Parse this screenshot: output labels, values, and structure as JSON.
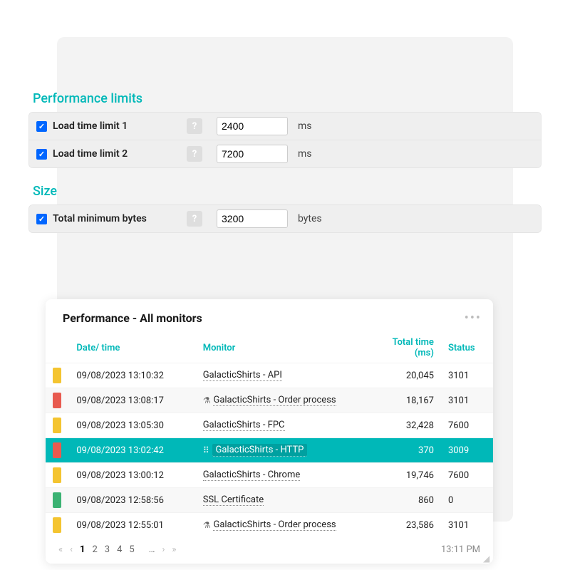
{
  "colors": {
    "accent": "#00b8b8",
    "chip_yellow": "#f4c430",
    "chip_red": "#e85a4f",
    "chip_green": "#3bb273"
  },
  "limits": {
    "title": "Performance limits",
    "rows": [
      {
        "label": "Load time limit 1",
        "value": "2400",
        "unit": "ms"
      },
      {
        "label": "Load time limit 2",
        "value": "7200",
        "unit": "ms"
      }
    ]
  },
  "size": {
    "title": "Size",
    "rows": [
      {
        "label": "Total minimum bytes",
        "value": "3200",
        "unit": "bytes"
      }
    ]
  },
  "monitorCard": {
    "title": "Performance - All monitors",
    "more": "•••",
    "columns": {
      "date": "Date/ time",
      "monitor": "Monitor",
      "total": "Total time (ms)",
      "status": "Status"
    },
    "rows": [
      {
        "chip": "yellow",
        "dt": "09/08/2023 13:10:32",
        "monitor": "GalacticShirts - API",
        "icon": "",
        "total": "20,045",
        "status": "3101",
        "underlined": true,
        "boxed": false,
        "highlight": false
      },
      {
        "chip": "red",
        "dt": "09/08/2023 13:08:17",
        "monitor": "GalacticShirts - Order process",
        "icon": "flask",
        "total": "18,167",
        "status": "3101",
        "underlined": true,
        "boxed": false,
        "highlight": false
      },
      {
        "chip": "yellow",
        "dt": "09/08/2023 13:05:30",
        "monitor": "GalacticShirts - FPC",
        "icon": "",
        "total": "32,428",
        "status": "7600",
        "underlined": true,
        "boxed": false,
        "highlight": false
      },
      {
        "chip": "red",
        "dt": "09/08/2023 13:02:42",
        "monitor": "GalacticShirts - HTTP",
        "icon": "grip",
        "total": "370",
        "status": "3009",
        "underlined": true,
        "boxed": true,
        "highlight": true
      },
      {
        "chip": "yellow",
        "dt": "09/08/2023 13:00:12",
        "monitor": "GalacticShirts - Chrome",
        "icon": "",
        "total": "19,746",
        "status": "7600",
        "underlined": true,
        "boxed": false,
        "highlight": false
      },
      {
        "chip": "green",
        "dt": "09/08/2023 12:58:56",
        "monitor": "SSL Certificate",
        "icon": "",
        "total": "860",
        "status": "0",
        "underlined": true,
        "boxed": false,
        "highlight": false
      },
      {
        "chip": "yellow",
        "dt": "09/08/2023 12:55:01",
        "monitor": "GalacticShirts - Order process",
        "icon": "flask",
        "total": "23,586",
        "status": "3101",
        "underlined": true,
        "boxed": false,
        "highlight": false
      }
    ],
    "pager": {
      "first": "«",
      "prev": "‹",
      "pages": [
        "1",
        "2",
        "3",
        "4",
        "5"
      ],
      "ellipsis": "…",
      "next": "›",
      "last": "»",
      "current": "1",
      "time": "13:11 PM"
    }
  }
}
